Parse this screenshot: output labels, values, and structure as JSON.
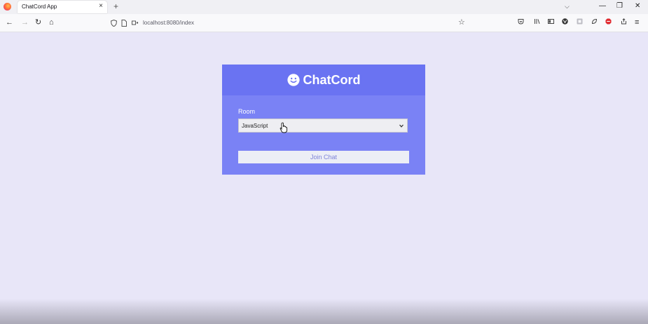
{
  "browser": {
    "tab_title": "ChatCord App",
    "tab_close": "×",
    "new_tab": "+",
    "tab_list": "⌵",
    "url": "localhost:8080/index",
    "controls": {
      "minimize": "—",
      "restore": "❐",
      "close": "✕"
    },
    "nav": {
      "back": "←",
      "forward": "→",
      "reload": "↻",
      "home": "⌂"
    },
    "bookmark": "☆",
    "menu": "≡"
  },
  "app": {
    "brand": "ChatCord",
    "room_label": "Room",
    "room_selected": "JavaScript",
    "join_label": "Join Chat"
  },
  "colors": {
    "page_bg": "#e8e6f8",
    "card_body": "#7a82f5",
    "card_header": "#6a73f2",
    "button_text": "#7d83d8"
  }
}
